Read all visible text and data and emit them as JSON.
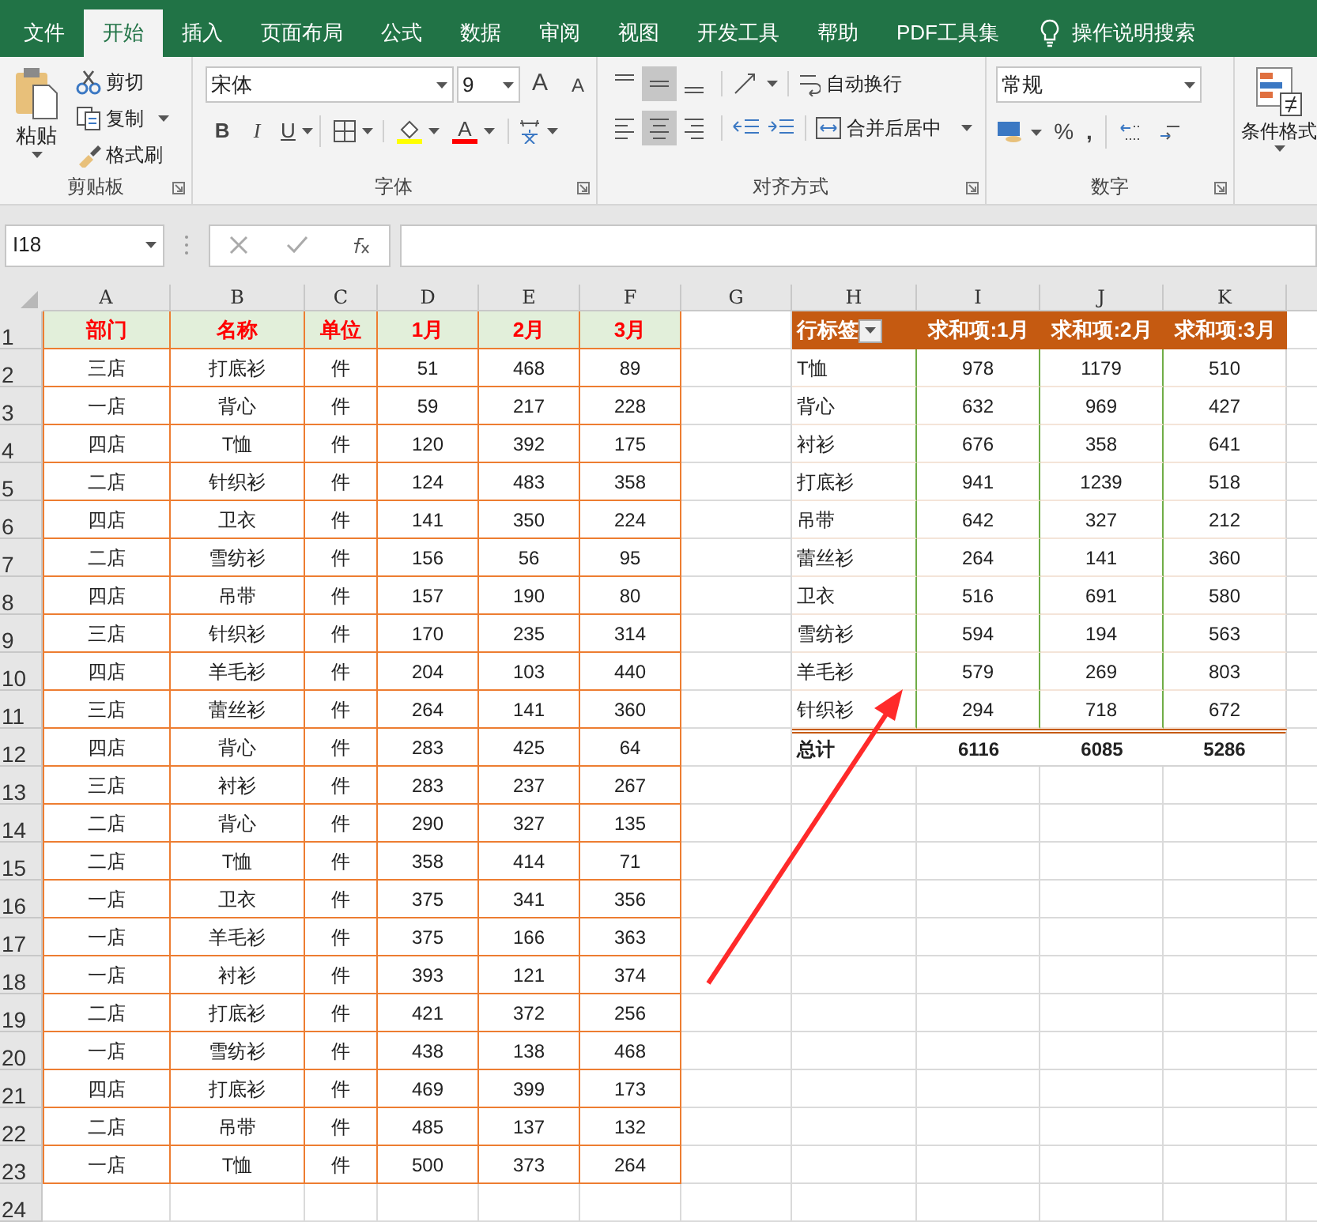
{
  "tabs": [
    {
      "label": "文件",
      "selected": false
    },
    {
      "label": "开始",
      "selected": true
    },
    {
      "label": "插入",
      "selected": false
    },
    {
      "label": "页面布局",
      "selected": false
    },
    {
      "label": "公式",
      "selected": false
    },
    {
      "label": "数据",
      "selected": false
    },
    {
      "label": "审阅",
      "selected": false
    },
    {
      "label": "视图",
      "selected": false
    },
    {
      "label": "开发工具",
      "selected": false
    },
    {
      "label": "帮助",
      "selected": false
    },
    {
      "label": "PDF工具集",
      "selected": false
    }
  ],
  "tell_me": "操作说明搜索",
  "ribbon": {
    "clipboard": {
      "label": "剪贴板",
      "paste": "粘贴",
      "cut": "剪切",
      "copy": "复制",
      "format_painter": "格式刷"
    },
    "font": {
      "label": "字体",
      "font_name": "宋体",
      "font_size": "9",
      "grow": "A",
      "shrink": "A",
      "bold": "B",
      "italic": "I",
      "underline": "U",
      "font_color": "A"
    },
    "alignment": {
      "label": "对齐方式",
      "vertical": [
        {
          "selected": false
        },
        {
          "selected": true
        },
        {
          "selected": false
        }
      ],
      "horizontal": [
        {
          "selected": false
        },
        {
          "selected": true
        },
        {
          "selected": false
        }
      ],
      "wrap_text": "自动换行",
      "merge_center": "合并后居中"
    },
    "number": {
      "label": "数字",
      "format": "常规",
      "percent": "%",
      "comma": ","
    },
    "styles": {
      "conditional_format": "条件格式"
    }
  },
  "name_box": "I18",
  "columns": [
    "A",
    "B",
    "C",
    "D",
    "E",
    "F",
    "G",
    "H",
    "I",
    "J",
    "K"
  ],
  "row_numbers": [
    "1",
    "2",
    "3",
    "4",
    "5",
    "6",
    "7",
    "8",
    "9",
    "10",
    "11",
    "12",
    "13",
    "14",
    "15",
    "16",
    "17",
    "18",
    "19",
    "20",
    "21",
    "22",
    "23",
    "24"
  ],
  "table": {
    "columns": [
      "部门",
      "名称",
      "单位",
      "1月",
      "2月",
      "3月"
    ],
    "rows": [
      [
        "三店",
        "打底衫",
        "件",
        "51",
        "468",
        "89"
      ],
      [
        "一店",
        "背心",
        "件",
        "59",
        "217",
        "228"
      ],
      [
        "四店",
        "T恤",
        "件",
        "120",
        "392",
        "175"
      ],
      [
        "二店",
        "针织衫",
        "件",
        "124",
        "483",
        "358"
      ],
      [
        "四店",
        "卫衣",
        "件",
        "141",
        "350",
        "224"
      ],
      [
        "二店",
        "雪纺衫",
        "件",
        "156",
        "56",
        "95"
      ],
      [
        "四店",
        "吊带",
        "件",
        "157",
        "190",
        "80"
      ],
      [
        "三店",
        "针织衫",
        "件",
        "170",
        "235",
        "314"
      ],
      [
        "四店",
        "羊毛衫",
        "件",
        "204",
        "103",
        "440"
      ],
      [
        "三店",
        "蕾丝衫",
        "件",
        "264",
        "141",
        "360"
      ],
      [
        "四店",
        "背心",
        "件",
        "283",
        "425",
        "64"
      ],
      [
        "三店",
        "衬衫",
        "件",
        "283",
        "237",
        "267"
      ],
      [
        "二店",
        "背心",
        "件",
        "290",
        "327",
        "135"
      ],
      [
        "二店",
        "T恤",
        "件",
        "358",
        "414",
        "71"
      ],
      [
        "一店",
        "卫衣",
        "件",
        "375",
        "341",
        "356"
      ],
      [
        "一店",
        "羊毛衫",
        "件",
        "375",
        "166",
        "363"
      ],
      [
        "一店",
        "衬衫",
        "件",
        "393",
        "121",
        "374"
      ],
      [
        "二店",
        "打底衫",
        "件",
        "421",
        "372",
        "256"
      ],
      [
        "一店",
        "雪纺衫",
        "件",
        "438",
        "138",
        "468"
      ],
      [
        "四店",
        "打底衫",
        "件",
        "469",
        "399",
        "173"
      ],
      [
        "二店",
        "吊带",
        "件",
        "485",
        "137",
        "132"
      ],
      [
        "一店",
        "T恤",
        "件",
        "500",
        "373",
        "264"
      ]
    ]
  },
  "pivot": {
    "columns": [
      "行标签",
      "求和项:1月",
      "求和项:2月",
      "求和项:3月"
    ],
    "rows": [
      [
        "T恤",
        "978",
        "1179",
        "510"
      ],
      [
        "背心",
        "632",
        "969",
        "427"
      ],
      [
        "衬衫",
        "676",
        "358",
        "641"
      ],
      [
        "打底衫",
        "941",
        "1239",
        "518"
      ],
      [
        "吊带",
        "642",
        "327",
        "212"
      ],
      [
        "蕾丝衫",
        "264",
        "141",
        "360"
      ],
      [
        "卫衣",
        "516",
        "691",
        "580"
      ],
      [
        "雪纺衫",
        "594",
        "194",
        "563"
      ],
      [
        "羊毛衫",
        "579",
        "269",
        "803"
      ],
      [
        "针织衫",
        "294",
        "718",
        "672"
      ]
    ],
    "total": [
      "总计",
      "6116",
      "6085",
      "5286"
    ]
  }
}
